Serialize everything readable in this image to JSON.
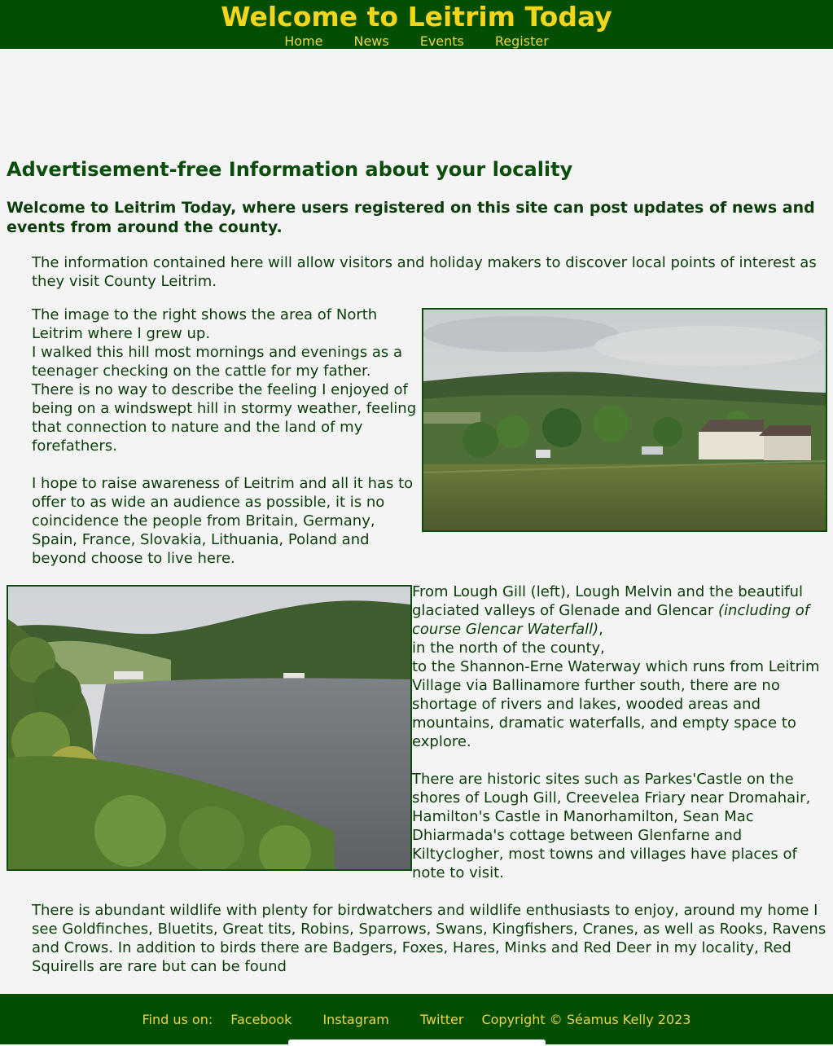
{
  "header": {
    "title": "Welcome to Leitrim Today",
    "nav": [
      "Home",
      "News",
      "Events",
      "Register"
    ]
  },
  "main": {
    "heading": "Advertisement-free Information about your locality",
    "subheading": "Welcome to Leitrim Today, where users registered on this site can post updates of news and events from around the county.",
    "intro": "The information contained here will allow visitors and holiday makers to discover local points of interest as they visit County Leitrim.",
    "north_lines": [
      "The image to the right shows the area of North",
      "Leitrim where I grew up.",
      "I walked this hill most mornings and evenings as a",
      "teenager checking on the cattle for my father.",
      "There is no way to describe the feeling I enjoyed of",
      "being on a windswept hill in stormy weather, feeling",
      "that connection to nature and the land of my",
      "forefathers."
    ],
    "awareness_lines": [
      "I hope to raise awareness of Leitrim and all it has to",
      "offer to as wide an audience as possible, it is no",
      "coincidence the people from Britain, Germany,",
      "Spain, France, Slovakia, Lithuania, Poland and",
      "beyond choose to live here."
    ],
    "lakes_a": "From Lough Gill (left), Lough Melvin and the beautiful glaciated valleys of Glenade and Glencar",
    "lakes_italic": "(including of course Glencar Waterfall)",
    "lakes_b": ",",
    "lakes_c": "in the north of the county,",
    "lakes_d": "to the Shannon-Erne Waterway which runs from Leitrim Village via Ballinamore further south, there are no shortage of rivers and lakes, wooded areas and mountains, dramatic waterfalls, and empty space to explore.",
    "historic": "There are historic sites such as Parkes'Castle on the shores of Lough Gill, Creevelea Friary near Dromahair, Hamilton's Castle in Manorhamilton, Sean Mac Dhiarmada's cottage between Glenfarne and Kiltyclogher, most towns and villages have places of note to visit.",
    "wildlife": "There is abundant wildlife with plenty for birdwatchers and wildlife enthusiasts to enjoy, around my home I see Goldfinches, Bluetits, Great tits, Robins, Sparrows, Swans, Kingfishers, Cranes, as well as Rooks, Ravens and Crows. In addition to birds there are Badgers, Foxes, Hares, Minks and Red Deer in my locality, Red Squirells are rare but can be found"
  },
  "footer": {
    "find_us": "Find us on:",
    "links": [
      "Facebook",
      "Instagram",
      "Twitter"
    ],
    "copyright": "Copyright © Séamus Kelly 2023"
  },
  "colors": {
    "header_bg": "#024f02",
    "title": "#f3d51c",
    "nav_link": "#e8d44a",
    "text": "#0a3d0a",
    "page_bg": "#f4f4f4"
  }
}
